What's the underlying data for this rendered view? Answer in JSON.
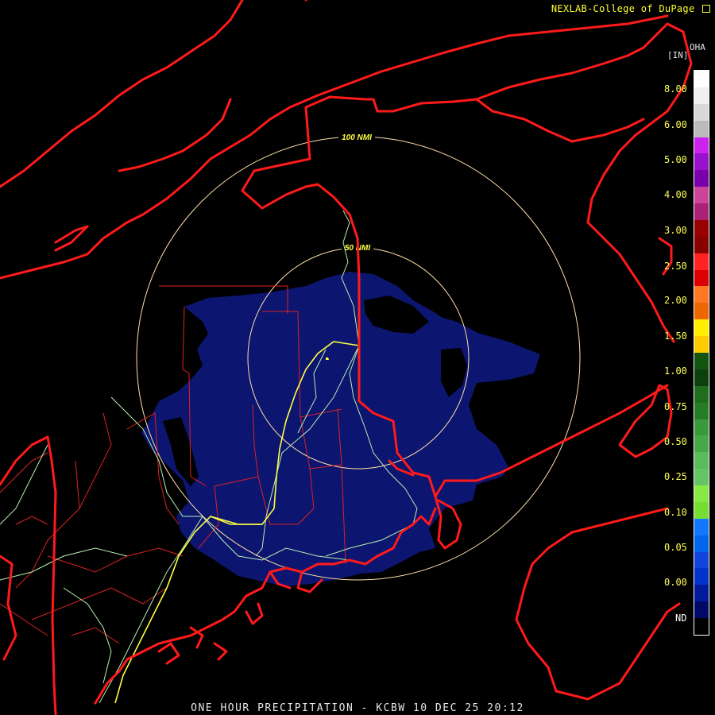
{
  "credit": "NEXLAB-College of DuPage",
  "footer": "ONE HOUR PRECIPITATION - KCBW 10 DEC 25 20:12",
  "range_rings": [
    {
      "label": "100 NMI",
      "radius_nmi": 100
    },
    {
      "label": "50 NMI",
      "radius_nmi": 50
    }
  ],
  "legend": {
    "product": "OHA",
    "units": "[IN]",
    "labels": [
      "8.00",
      "6.00",
      "5.00",
      "4.00",
      "3.00",
      "2.50",
      "2.00",
      "1.50",
      "1.00",
      "0.75",
      "0.50",
      "0.25",
      "0.10",
      "0.05",
      "0.00",
      "ND"
    ],
    "label_colors": {
      "default": "#ffff55",
      "nd": "#ffffff"
    },
    "colors": [
      "#ffffff",
      "#f0f0f0",
      "#d8d8d8",
      "#bbbbbb",
      "#cc22ee",
      "#9911cc",
      "#7700aa",
      "#cc4499",
      "#aa2277",
      "#990000",
      "#880000",
      "#ff2222",
      "#dd0000",
      "#ff7722",
      "#ee6600",
      "#ffee00",
      "#ffcc00",
      "#115511",
      "#0c400c",
      "#1e6e1e",
      "#267d26",
      "#3a993a",
      "#46a846",
      "#5bbb5b",
      "#66c466",
      "#88e844",
      "#77dd33",
      "#1177ff",
      "#0066ee",
      "#1144dd",
      "#0033cc",
      "#001a99",
      "#000a66",
      "#000000"
    ]
  },
  "colors": {
    "coast": "#ff1a1a",
    "county": "#dd2222",
    "rivers": "#b8f0b0",
    "highway": "#ffff44",
    "echo": "#0c1570",
    "ring": "#ffe0a8",
    "ring_label": "#ffff44"
  }
}
